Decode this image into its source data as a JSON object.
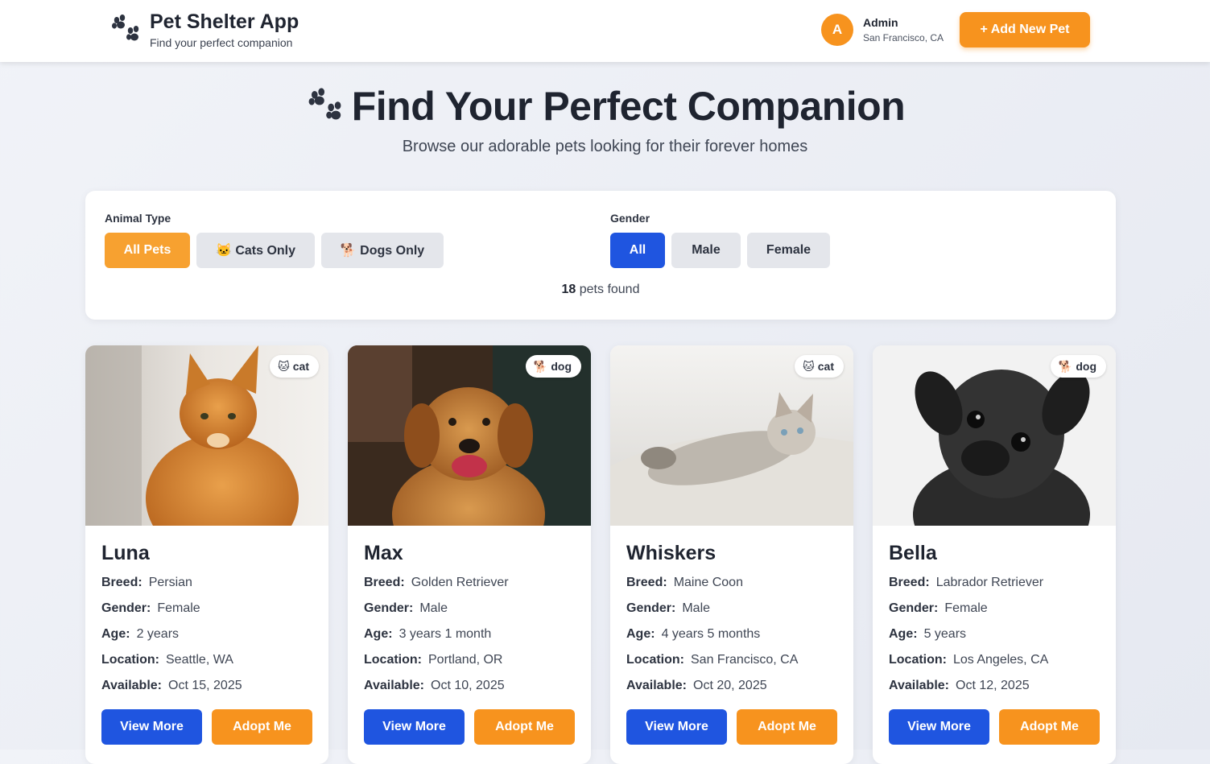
{
  "header": {
    "title": "Pet Shelter App",
    "subtitle": "Find your perfect companion",
    "user": {
      "initial": "A",
      "name": "Admin",
      "location": "San Francisco, CA"
    },
    "add_button": "+ Add New Pet"
  },
  "hero": {
    "title": "Find Your Perfect Companion",
    "subtitle": "Browse our adorable pets looking for their forever homes"
  },
  "filters": {
    "animal_type_label": "Animal Type",
    "animal_types": [
      "All Pets",
      "🐱 Cats Only",
      "🐕 Dogs Only"
    ],
    "animal_selected": "All Pets",
    "gender_label": "Gender",
    "genders": [
      "All",
      "Male",
      "Female"
    ],
    "gender_selected": "All",
    "count": "18",
    "count_suffix": "pets found"
  },
  "labels": {
    "breed": "Breed:",
    "gender": "Gender:",
    "age": "Age:",
    "location": "Location:",
    "available": "Available:",
    "view_more": "View More",
    "adopt_me": "Adopt Me"
  },
  "colors": {
    "accent_orange": "#f7931e",
    "accent_blue": "#1f55e0"
  },
  "pets": [
    {
      "name": "Luna",
      "type": "cat",
      "type_icon": "🐱",
      "breed": "Persian",
      "gender": "Female",
      "age": "2 years",
      "location": "Seattle, WA",
      "available": "Oct 15, 2025"
    },
    {
      "name": "Max",
      "type": "dog",
      "type_icon": "🐕",
      "breed": "Golden Retriever",
      "gender": "Male",
      "age": "3 years 1 month",
      "location": "Portland, OR",
      "available": "Oct 10, 2025"
    },
    {
      "name": "Whiskers",
      "type": "cat",
      "type_icon": "🐱",
      "breed": "Maine Coon",
      "gender": "Male",
      "age": "4 years 5 months",
      "location": "San Francisco, CA",
      "available": "Oct 20, 2025"
    },
    {
      "name": "Bella",
      "type": "dog",
      "type_icon": "🐕",
      "breed": "Labrador Retriever",
      "gender": "Female",
      "age": "5 years",
      "location": "Los Angeles, CA",
      "available": "Oct 12, 2025"
    }
  ]
}
